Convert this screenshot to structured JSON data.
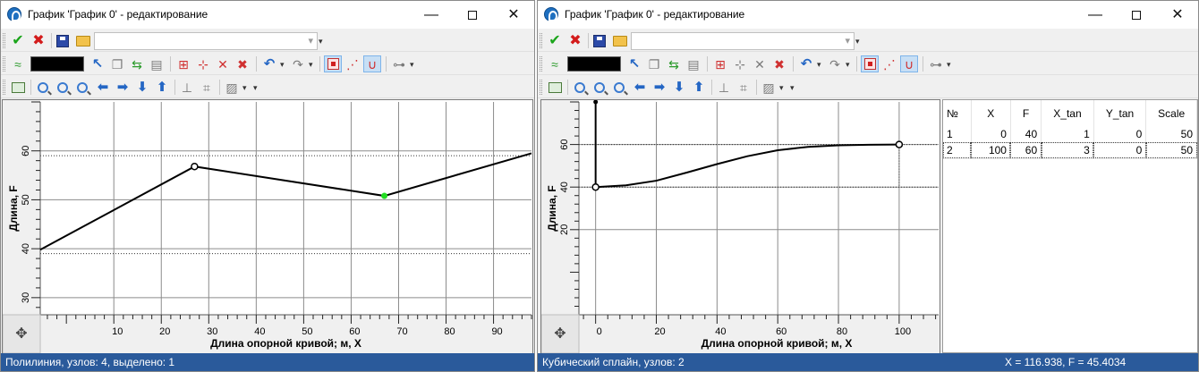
{
  "left": {
    "title": "График 'График 0' - редактирование",
    "status": "Полилиния, узлов: 4, выделено: 1",
    "chart_data": {
      "type": "line",
      "xlabel": "Длина опорной кривой; м, X",
      "ylabel": "Длина, F",
      "xlim": [
        -5.5,
        98
      ],
      "ylim": [
        26.5,
        70
      ],
      "x_ticks": [
        10,
        20,
        30,
        40,
        50,
        60,
        70,
        80,
        90
      ],
      "y_ticks": [
        30,
        40,
        50,
        60
      ],
      "grid": true,
      "reference_lines_y": [
        39,
        59
      ],
      "series": [
        {
          "points": [
            [
              -5.5,
              39.8
            ],
            [
              27,
              56.8
            ],
            [
              67,
              50.8
            ],
            [
              98,
              59.5
            ]
          ],
          "node_markers": [
            [
              27,
              56.8
            ],
            [
              67,
              50.8
            ]
          ],
          "selected_node": [
            67,
            50.8
          ]
        }
      ],
      "node_color": "#ffffff",
      "selected_color": "#22dd22",
      "line_color": "#000000"
    }
  },
  "right": {
    "title": "График 'График 0' - редактирование",
    "status_left": "Кубический сплайн, узлов: 2",
    "status_right": "X = 116.938, F = 45.4034",
    "chart_data": {
      "type": "line",
      "xlabel": "Длина опорной кривой; м, X",
      "ylabel": "Длина, F",
      "xlim": [
        -5.5,
        113
      ],
      "ylim": [
        -20,
        80
      ],
      "x_ticks": [
        0,
        20,
        40,
        60,
        80,
        100
      ],
      "y_ticks": [
        20,
        40,
        60
      ],
      "grid": true,
      "reference_lines_y": [
        40,
        60
      ],
      "series": [
        {
          "points": [
            [
              0,
              40
            ],
            [
              10,
              40.8
            ],
            [
              20,
              43
            ],
            [
              30,
              46.8
            ],
            [
              40,
              50.8
            ],
            [
              50,
              54.5
            ],
            [
              60,
              57.3
            ],
            [
              70,
              58.9
            ],
            [
              80,
              59.6
            ],
            [
              90,
              59.9
            ],
            [
              100,
              60
            ]
          ],
          "node_markers": [
            [
              0,
              40
            ],
            [
              100,
              60
            ]
          ],
          "tangent_start": [
            0,
            80
          ]
        }
      ],
      "line_color": "#000000"
    },
    "table": {
      "columns": [
        "№",
        "X",
        "F",
        "X_tan",
        "Y_tan",
        "Scale"
      ],
      "rows": [
        [
          "1",
          "0",
          "40",
          "1",
          "0",
          "50"
        ],
        [
          "2",
          "100",
          "60",
          "3",
          "0",
          "50"
        ]
      ]
    }
  }
}
